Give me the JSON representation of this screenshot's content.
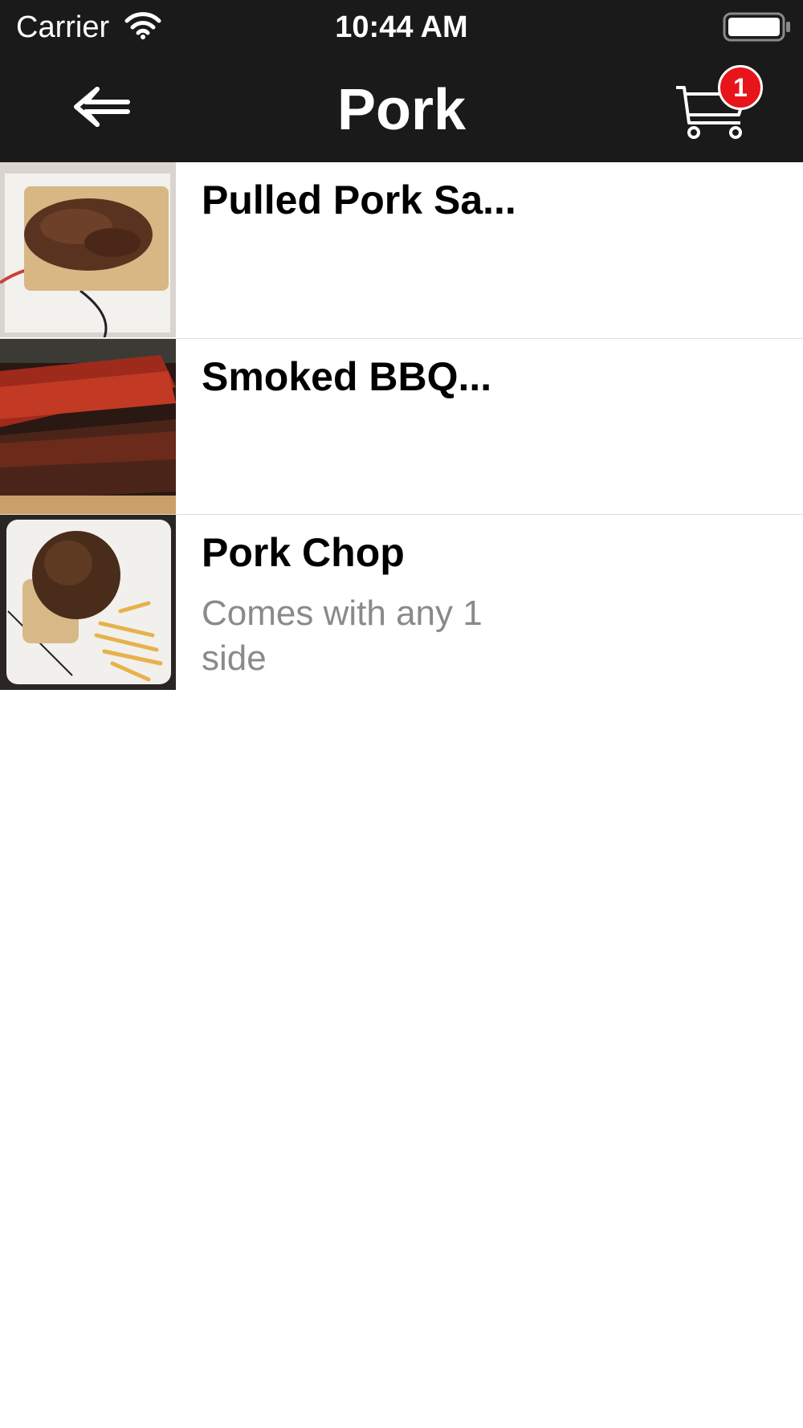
{
  "status_bar": {
    "carrier": "Carrier",
    "time": "10:44 AM",
    "wifi_icon": "wifi-icon",
    "battery_icon": "battery-icon"
  },
  "nav": {
    "title": "Pork",
    "back_icon": "back-arrow-icon",
    "cart_icon": "shopping-cart-icon",
    "cart_count": "1",
    "badge_color": "#e8141b",
    "bar_color": "#1a1a1a"
  },
  "items": [
    {
      "name": "Pulled Pork Sa...",
      "description": "",
      "image": "pulled-pork-sandwich-photo"
    },
    {
      "name": "Smoked BBQ...",
      "description": "",
      "image": "smoked-bbq-ribs-photo"
    },
    {
      "name": "Pork Chop",
      "description": "Comes with any 1 side",
      "image": "pork-chop-photo"
    }
  ]
}
